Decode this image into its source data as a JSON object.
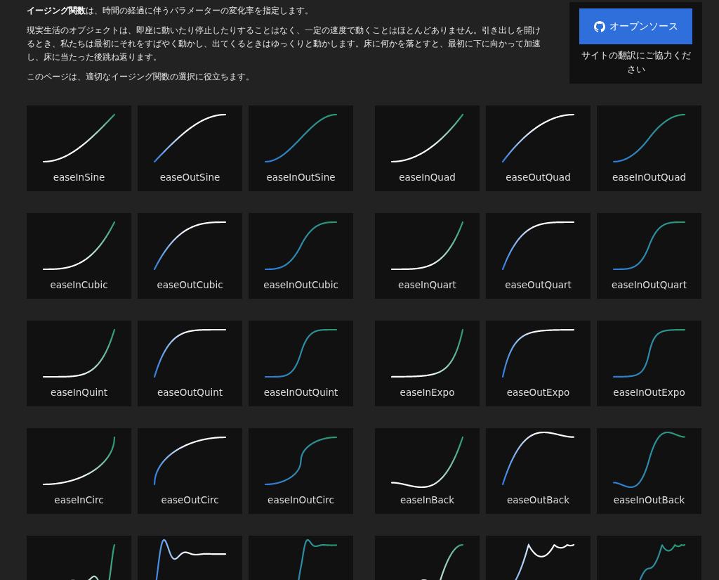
{
  "intro": {
    "paragraphs": [
      "**イージング関数**は、時間の経過に伴うパラメーターの変化率を指定します。",
      "現実生活のオブジェクトは、即座に動いたり停止したりすることはなく、一定の速度で動くことはほとんどありません。引き出しを開けるとき、私たちは最初にそれをすばやく動かし、出てくるときはゆっくりと動かします。床に何かを落とすと、最初に下に向かって加速し、床に当たった後跳ね返ります。",
      "このページは、適切なイージング関数の選択に役立ちます。"
    ]
  },
  "aside": {
    "button": "オープンソース",
    "note": "サイトの翻訳にご協力ください"
  },
  "cards": [
    {
      "label": "easeInSine",
      "kind": "sinein"
    },
    {
      "label": "easeOutSine",
      "kind": "sineout"
    },
    {
      "label": "easeInOutSine",
      "kind": "sineinout"
    },
    {
      "label": "easeInQuad",
      "kind": "quadin"
    },
    {
      "label": "easeOutQuad",
      "kind": "quadout"
    },
    {
      "label": "easeInOutQuad",
      "kind": "quadinout"
    },
    {
      "label": "easeInCubic",
      "kind": "cubicin"
    },
    {
      "label": "easeOutCubic",
      "kind": "cubicout"
    },
    {
      "label": "easeInOutCubic",
      "kind": "cubicinout"
    },
    {
      "label": "easeInQuart",
      "kind": "quartin"
    },
    {
      "label": "easeOutQuart",
      "kind": "quartout"
    },
    {
      "label": "easeInOutQuart",
      "kind": "quartinout"
    },
    {
      "label": "easeInQuint",
      "kind": "quintin"
    },
    {
      "label": "easeOutQuint",
      "kind": "quintout"
    },
    {
      "label": "easeInOutQuint",
      "kind": "quintinout"
    },
    {
      "label": "easeInExpo",
      "kind": "expoin"
    },
    {
      "label": "easeOutExpo",
      "kind": "expoout"
    },
    {
      "label": "easeInOutExpo",
      "kind": "expoinout"
    },
    {
      "label": "easeInCirc",
      "kind": "circin"
    },
    {
      "label": "easeOutCirc",
      "kind": "circout"
    },
    {
      "label": "easeInOutCirc",
      "kind": "circinout"
    },
    {
      "label": "easeInBack",
      "kind": "backin"
    },
    {
      "label": "easeOutBack",
      "kind": "backout"
    },
    {
      "label": "easeInOutBack",
      "kind": "backinout"
    },
    {
      "kind": "elasticin"
    },
    {
      "kind": "elasticout"
    },
    {
      "kind": "elasticinout"
    },
    {
      "kind": "bouncein"
    },
    {
      "kind": "bounceout"
    },
    {
      "kind": "bounceinout"
    }
  ]
}
